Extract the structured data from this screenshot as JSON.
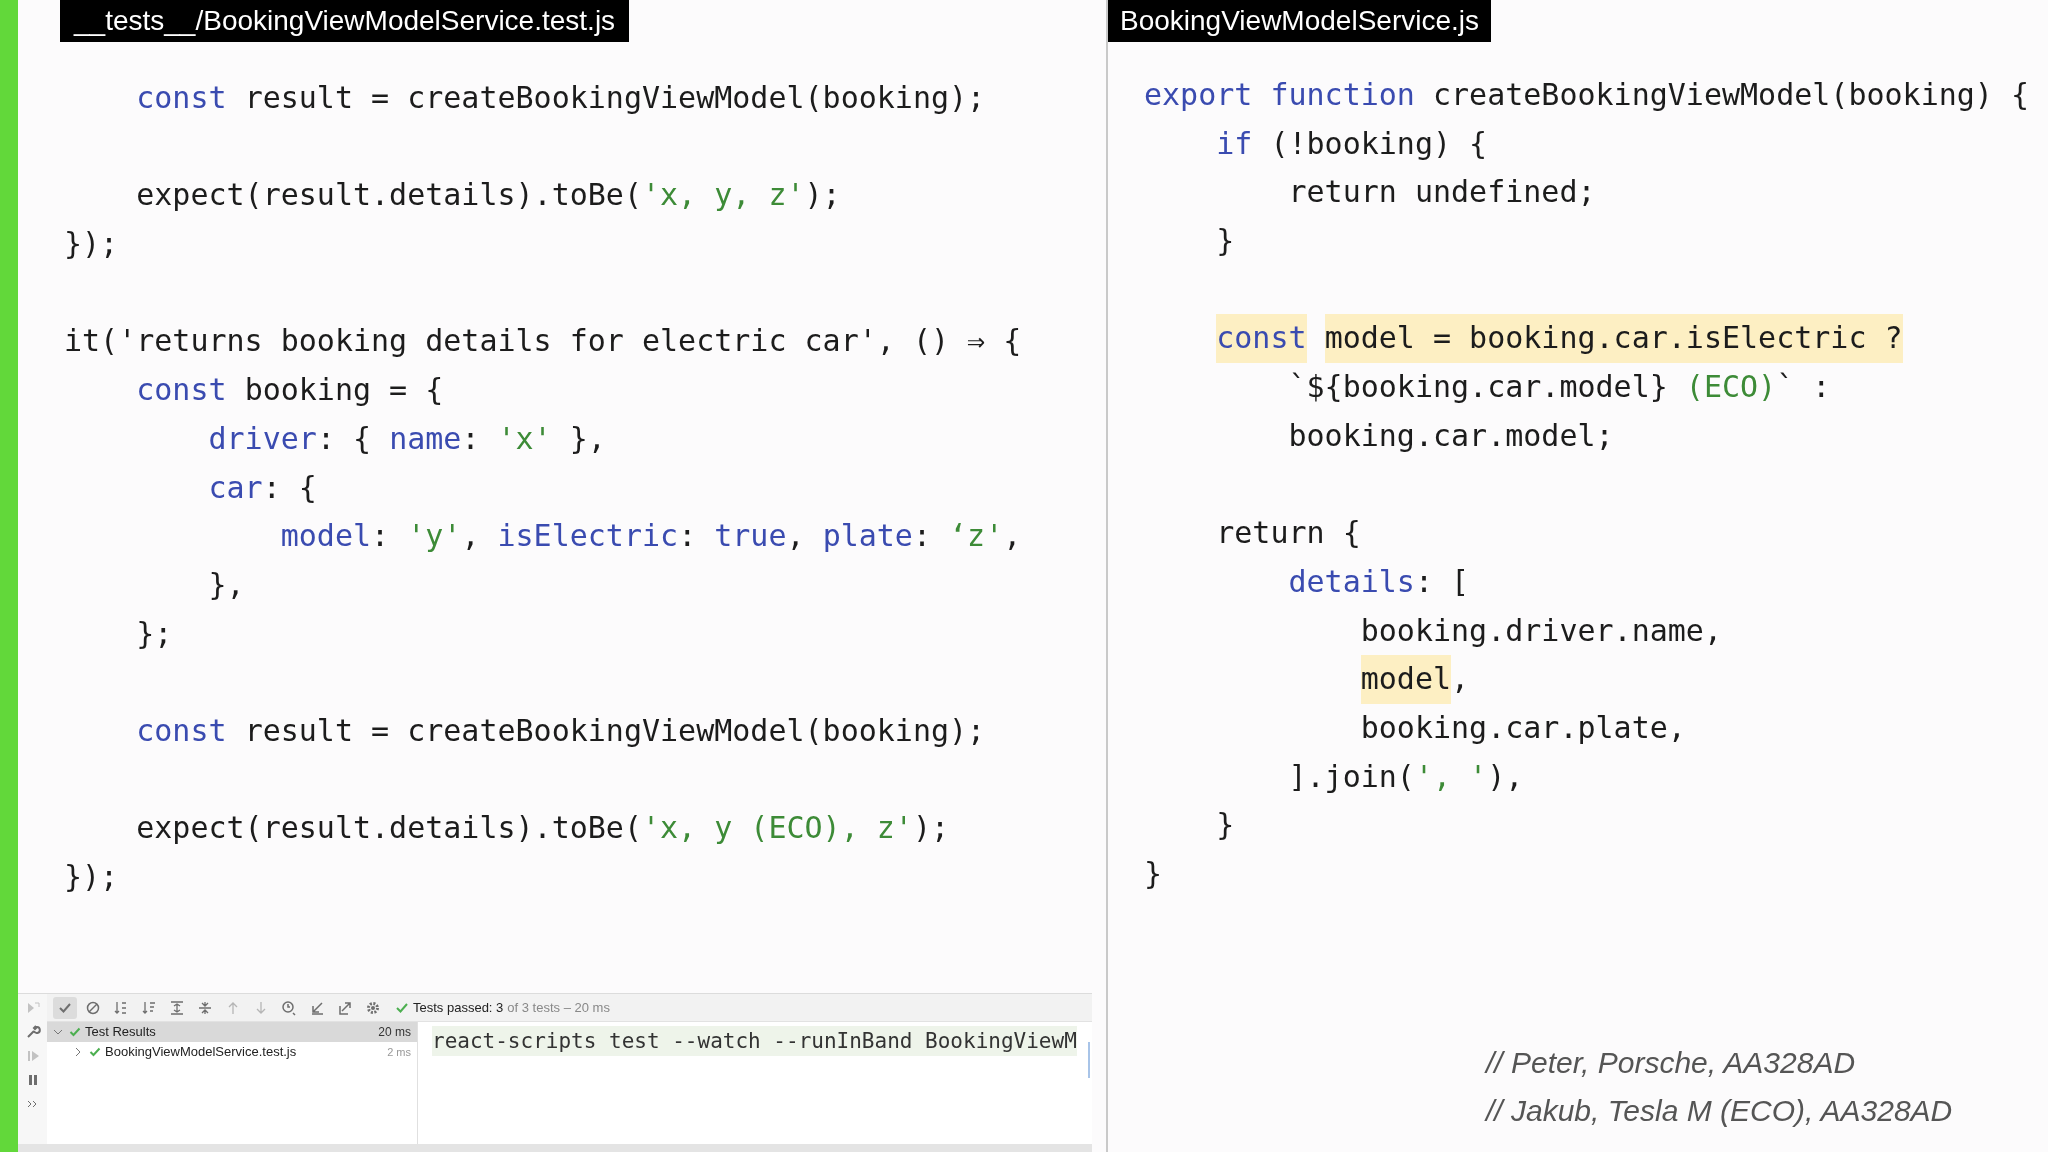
{
  "left_editor": {
    "tab": "__tests__/BookingViewModelService.test.js",
    "lines": [
      {
        "tokens": [
          {
            "t": "    const",
            "kind": "keyword"
          },
          {
            "t": " result = createBookingViewModel(booking);",
            "kind": "plain"
          }
        ],
        "blank_after": true
      },
      {
        "tokens": [
          {
            "t": "    expect(result.details).toBe(",
            "kind": "plain"
          },
          {
            "t": "'x, y, z'",
            "kind": "string"
          },
          {
            "t": ");",
            "kind": "plain"
          }
        ]
      },
      {
        "tokens": [
          {
            "t": "});",
            "kind": "plain"
          }
        ],
        "blank_after": true
      },
      {
        "tokens": [
          {
            "t": "it('returns booking details for electric car', () ⇒ {",
            "kind": "plain"
          }
        ]
      },
      {
        "tokens": [
          {
            "t": "    const",
            "kind": "keyword"
          },
          {
            "t": " booking = {",
            "kind": "plain"
          }
        ]
      },
      {
        "tokens": [
          {
            "t": "        driver",
            "kind": "property"
          },
          {
            "t": ": { ",
            "kind": "plain"
          },
          {
            "t": "name",
            "kind": "property"
          },
          {
            "t": ": ",
            "kind": "plain"
          },
          {
            "t": "'x'",
            "kind": "string"
          },
          {
            "t": " },",
            "kind": "plain"
          }
        ]
      },
      {
        "tokens": [
          {
            "t": "        car",
            "kind": "property"
          },
          {
            "t": ": {",
            "kind": "plain"
          }
        ]
      },
      {
        "tokens": [
          {
            "t": "            model",
            "kind": "property"
          },
          {
            "t": ": ",
            "kind": "plain"
          },
          {
            "t": "'y'",
            "kind": "string"
          },
          {
            "t": ", ",
            "kind": "plain"
          },
          {
            "t": "isElectric",
            "kind": "property"
          },
          {
            "t": ": ",
            "kind": "plain"
          },
          {
            "t": "true",
            "kind": "keyword"
          },
          {
            "t": ", ",
            "kind": "plain"
          },
          {
            "t": "plate",
            "kind": "property"
          },
          {
            "t": ": ",
            "kind": "plain"
          },
          {
            "t": "‘z'",
            "kind": "string"
          },
          {
            "t": ",",
            "kind": "plain"
          }
        ]
      },
      {
        "tokens": [
          {
            "t": "        },",
            "kind": "plain"
          }
        ]
      },
      {
        "tokens": [
          {
            "t": "    };",
            "kind": "plain"
          }
        ],
        "blank_after": true
      },
      {
        "tokens": [
          {
            "t": "    const",
            "kind": "keyword"
          },
          {
            "t": " result = createBookingViewModel(booking);",
            "kind": "plain"
          }
        ],
        "blank_after": true
      },
      {
        "tokens": [
          {
            "t": "    expect(result.details).toBe(",
            "kind": "plain"
          },
          {
            "t": "'x, y (ECO), z'",
            "kind": "string"
          },
          {
            "t": ");",
            "kind": "plain"
          }
        ]
      },
      {
        "tokens": [
          {
            "t": "});",
            "kind": "plain"
          }
        ]
      }
    ]
  },
  "test_panel": {
    "side_tools": [
      {
        "kind": "rerun",
        "disabled": true
      },
      {
        "kind": "wrench",
        "disabled": false
      },
      {
        "kind": "resume",
        "disabled": true
      },
      {
        "kind": "pause",
        "disabled": false
      },
      {
        "kind": "more",
        "disabled": false
      }
    ],
    "toolbar": [
      {
        "kind": "check",
        "selected": true
      },
      {
        "kind": "stop",
        "selected": false
      },
      {
        "kind": "sort-alpha",
        "selected": false
      },
      {
        "kind": "sort-duration",
        "selected": false
      },
      {
        "kind": "expand",
        "selected": false
      },
      {
        "kind": "collapse",
        "selected": false
      },
      {
        "kind": "up",
        "selected": false
      },
      {
        "kind": "down",
        "selected": false
      },
      {
        "kind": "history",
        "selected": false
      },
      {
        "kind": "import",
        "selected": false
      },
      {
        "kind": "export",
        "selected": false
      },
      {
        "kind": "gear",
        "selected": false
      }
    ],
    "status": "Tests passed: 3",
    "status_detail": "of 3 tests – 20 ms",
    "tree": [
      {
        "label": "Test Results",
        "time": "20 ms",
        "expanded": true,
        "selected": true,
        "children": [
          {
            "label": "BookingViewModelService.test.js",
            "time": "2 ms",
            "expanded": false,
            "selected": false
          }
        ]
      }
    ],
    "console": "react-scripts test --watch --runInBand BookingViewM"
  },
  "right_editor": {
    "tab": "BookingViewModelService.js",
    "lines": [
      {
        "tokens": [
          {
            "t": "export",
            "kind": "keyword"
          },
          {
            "t": " function",
            "kind": "keyword"
          },
          {
            "t": " createBookingViewModel(booking) {",
            "kind": "plain"
          }
        ]
      },
      {
        "tokens": [
          {
            "t": "    if",
            "kind": "keyword"
          },
          {
            "t": " (!booking) {",
            "kind": "plain"
          }
        ]
      },
      {
        "tokens": [
          {
            "t": "        return undefined;",
            "kind": "plain"
          }
        ]
      },
      {
        "tokens": [
          {
            "t": "    }",
            "kind": "plain"
          }
        ],
        "blank_after": true
      },
      {
        "tokens": [
          {
            "t": "    const",
            "kind": "keyword",
            "highlight": true
          },
          {
            "t": " model = booking.car.isElectric ?",
            "kind": "plain",
            "highlight": true
          }
        ]
      },
      {
        "tokens": [
          {
            "t": "        `${booking.car.model} ",
            "kind": "plain"
          },
          {
            "t": "(ECO)",
            "kind": "string"
          },
          {
            "t": "` :",
            "kind": "plain"
          }
        ]
      },
      {
        "tokens": [
          {
            "t": "        booking.car.model;",
            "kind": "plain"
          }
        ],
        "blank_after": true
      },
      {
        "tokens": [
          {
            "t": "    return {",
            "kind": "plain"
          }
        ]
      },
      {
        "tokens": [
          {
            "t": "        details",
            "kind": "property"
          },
          {
            "t": ": [",
            "kind": "plain"
          }
        ]
      },
      {
        "tokens": [
          {
            "t": "            booking.driver.name,",
            "kind": "plain"
          }
        ]
      },
      {
        "tokens": [
          {
            "t": "            model",
            "kind": "plain",
            "highlight": true
          },
          {
            "t": ",",
            "kind": "plain"
          }
        ]
      },
      {
        "tokens": [
          {
            "t": "            booking.car.plate,",
            "kind": "plain"
          }
        ]
      },
      {
        "tokens": [
          {
            "t": "        ].join(",
            "kind": "plain"
          },
          {
            "t": "', '",
            "kind": "string"
          },
          {
            "t": "),",
            "kind": "plain"
          }
        ]
      },
      {
        "tokens": [
          {
            "t": "    }",
            "kind": "plain"
          }
        ]
      },
      {
        "tokens": [
          {
            "t": "}",
            "kind": "plain"
          }
        ]
      }
    ],
    "comments": [
      "// Peter, Porsche, AA328AD",
      "// Jakub, Tesla M (ECO), AA328AD"
    ]
  }
}
